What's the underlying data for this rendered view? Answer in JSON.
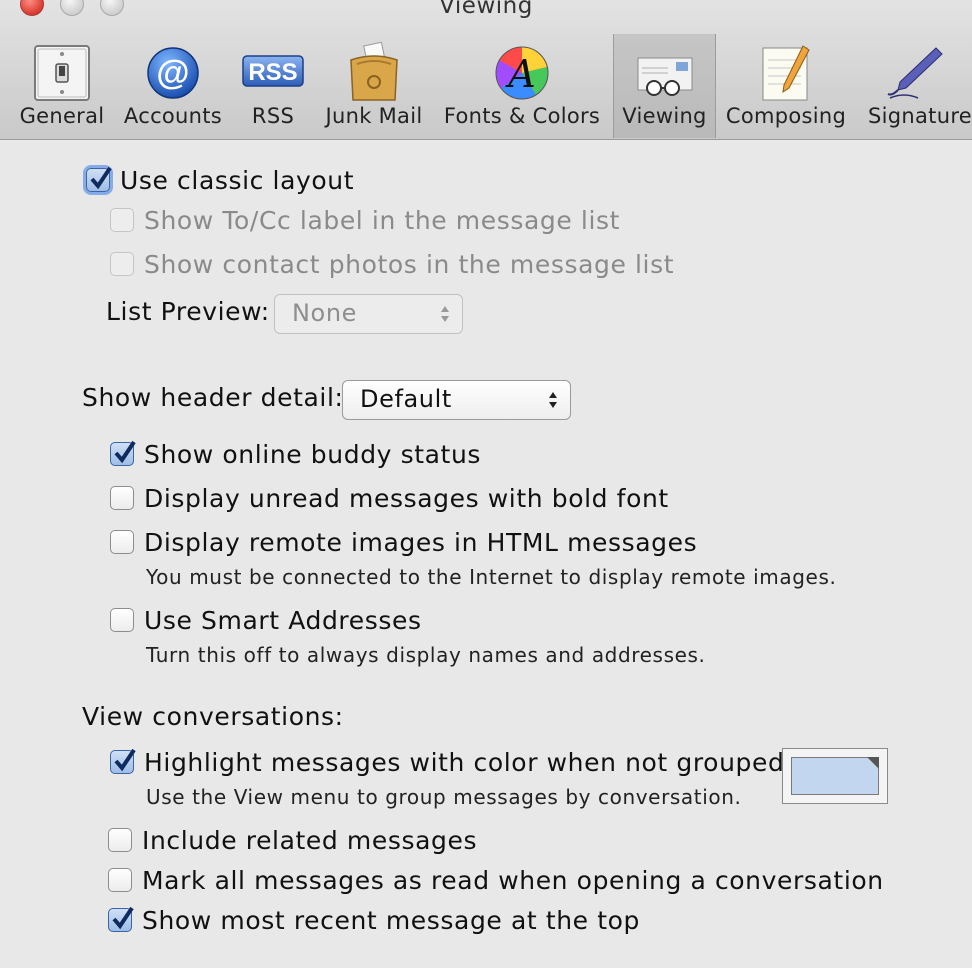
{
  "window": {
    "title": "Viewing"
  },
  "toolbar": {
    "items": [
      {
        "id": "general",
        "label": "General",
        "icon": "light-switch-icon"
      },
      {
        "id": "accounts",
        "label": "Accounts",
        "icon": "at-sign-icon"
      },
      {
        "id": "rss",
        "label": "RSS",
        "icon": "rss-badge-icon"
      },
      {
        "id": "junk",
        "label": "Junk Mail",
        "icon": "junk-mail-bag-icon"
      },
      {
        "id": "fonts",
        "label": "Fonts & Colors",
        "icon": "font-color-wheel-icon"
      },
      {
        "id": "viewing",
        "label": "Viewing",
        "icon": "glasses-envelope-icon",
        "selected": true
      },
      {
        "id": "composing",
        "label": "Composing",
        "icon": "notepad-pencil-icon"
      },
      {
        "id": "signatures",
        "label": "Signatures",
        "icon": "fountain-pen-icon"
      }
    ],
    "rss_badge_text": "RSS",
    "accounts_glyph": "@",
    "fonts_glyph": "A"
  },
  "classic_layout": {
    "label": "Use classic layout",
    "checked": true,
    "show_tocc": {
      "label": "Show To/Cc label in the message list",
      "checked": false,
      "enabled": false
    },
    "show_photos": {
      "label": "Show contact photos in the message list",
      "checked": false,
      "enabled": false
    },
    "list_preview": {
      "label": "List Preview:",
      "value": "None",
      "enabled": false
    }
  },
  "header_detail": {
    "label": "Show header detail:",
    "value": "Default"
  },
  "options": {
    "buddy_status": {
      "label": "Show online buddy status",
      "checked": true
    },
    "bold_unread": {
      "label": "Display unread messages with bold font",
      "checked": false
    },
    "remote_images": {
      "label": "Display remote images in HTML messages",
      "checked": false,
      "note": "You must be connected to the Internet to display remote images."
    },
    "smart_addresses": {
      "label": "Use Smart Addresses",
      "checked": false,
      "note": "Turn this off to always display names and addresses."
    }
  },
  "conversations": {
    "heading": "View conversations:",
    "highlight": {
      "label": "Highlight messages with color when not grouped",
      "checked": true,
      "note": "Use the View menu to group messages by conversation.",
      "color": "#c3d6f0"
    },
    "related": {
      "label": "Include related messages",
      "checked": false
    },
    "mark_read": {
      "label": "Mark all messages as read when opening a conversation",
      "checked": false
    },
    "recent_top": {
      "label": "Show most recent message at the top",
      "checked": true
    }
  },
  "colors": {
    "accent": "#3a63a8",
    "disabled_text": "#8a8a8a"
  }
}
